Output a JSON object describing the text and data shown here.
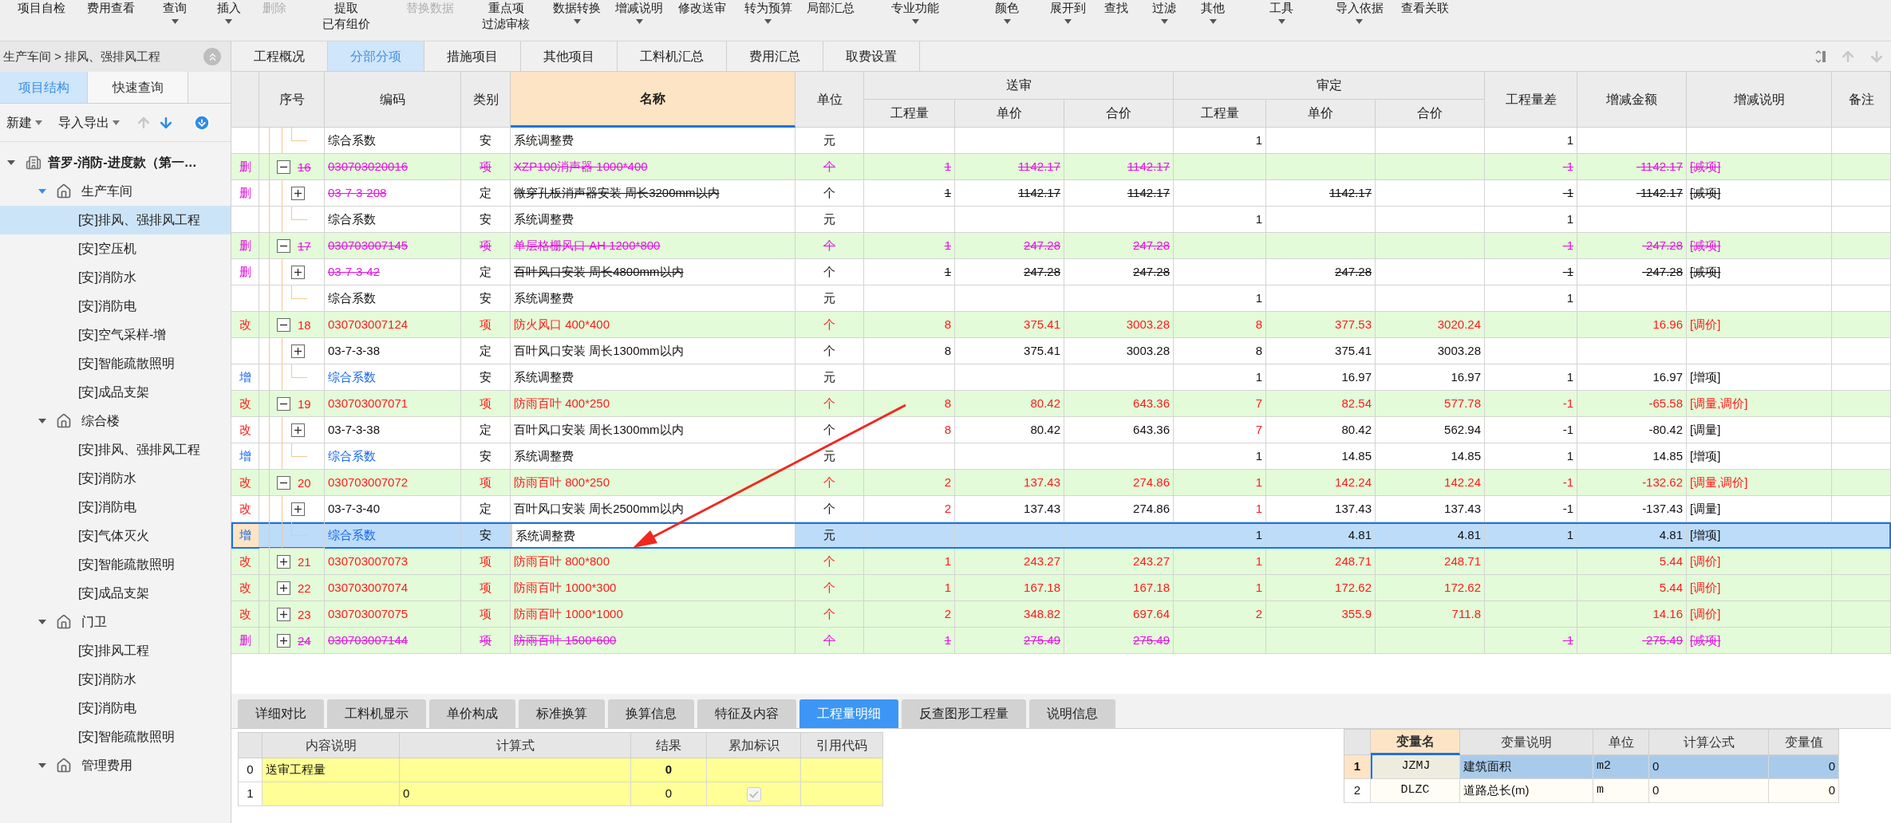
{
  "toolbar": [
    {
      "lines": [
        "项目自检"
      ],
      "dropdown": false,
      "disabled": false
    },
    {
      "lines": [
        "费用查看"
      ],
      "dropdown": false,
      "disabled": false
    },
    {
      "lines": [
        "查询"
      ],
      "dropdown": true,
      "disabled": false
    },
    {
      "lines": [
        "插入"
      ],
      "dropdown": true,
      "disabled": false
    },
    {
      "lines": [
        "删除"
      ],
      "dropdown": false,
      "disabled": true
    },
    {
      "lines": [
        "提取",
        "已有组价"
      ],
      "dropdown": false,
      "disabled": false
    },
    {
      "lines": [
        "替换数据"
      ],
      "dropdown": false,
      "disabled": true
    },
    {
      "lines": [
        "重点项",
        "过滤审核"
      ],
      "dropdown": false,
      "disabled": false
    },
    {
      "lines": [
        "数据转换"
      ],
      "dropdown": true,
      "disabled": false
    },
    {
      "lines": [
        "增减说明"
      ],
      "dropdown": true,
      "disabled": false
    },
    {
      "lines": [
        "修改送审"
      ],
      "dropdown": false,
      "disabled": false
    },
    {
      "lines": [
        "转为预算"
      ],
      "dropdown": true,
      "disabled": false
    },
    {
      "lines": [
        "局部汇总"
      ],
      "dropdown": false,
      "disabled": false
    },
    {
      "lines": [
        "专业功能"
      ],
      "dropdown": true,
      "disabled": false
    },
    {
      "lines": [
        "颜色"
      ],
      "dropdown": true,
      "disabled": false
    },
    {
      "lines": [
        "展开到"
      ],
      "dropdown": true,
      "disabled": false
    },
    {
      "lines": [
        "查找"
      ],
      "dropdown": false,
      "disabled": false
    },
    {
      "lines": [
        "过滤"
      ],
      "dropdown": true,
      "disabled": false
    },
    {
      "lines": [
        "其他"
      ],
      "dropdown": true,
      "disabled": false
    },
    {
      "lines": [
        "工具"
      ],
      "dropdown": true,
      "disabled": false
    },
    {
      "lines": [
        "导入依据"
      ],
      "dropdown": true,
      "disabled": false
    },
    {
      "lines": [
        "查看关联"
      ],
      "dropdown": false,
      "disabled": false
    }
  ],
  "sidebar": {
    "breadcrumb": "生产车间 > 排风、强排风工程",
    "tabs": [
      {
        "label": "项目结构",
        "selected": true
      },
      {
        "label": "快速查询",
        "selected": false
      }
    ],
    "actions": [
      {
        "label": "新建",
        "dropdown": true
      },
      {
        "label": "导入导出",
        "dropdown": true
      }
    ],
    "tree": {
      "label": "普罗-消防-进度款（第一…",
      "expanded": true,
      "selected": false,
      "children": [
        {
          "label": "生产车间",
          "expanded": true,
          "selected": false,
          "children": [
            {
              "label": "[安]排风、强排风工程",
              "selected": true
            },
            {
              "label": "[安]空压机",
              "selected": false
            },
            {
              "label": "[安]消防水",
              "selected": false
            },
            {
              "label": "[安]消防电",
              "selected": false
            },
            {
              "label": "[安]空气采样-增",
              "selected": false
            },
            {
              "label": "[安]智能疏散照明",
              "selected": false
            },
            {
              "label": "[安]成品支架",
              "selected": false
            }
          ]
        },
        {
          "label": "综合楼",
          "expanded": true,
          "selected": false,
          "children": [
            {
              "label": "[安]排风、强排风工程",
              "selected": false
            },
            {
              "label": "[安]消防水",
              "selected": false
            },
            {
              "label": "[安]消防电",
              "selected": false
            },
            {
              "label": "[安]气体灭火",
              "selected": false
            },
            {
              "label": "[安]智能疏散照明",
              "selected": false
            },
            {
              "label": "[安]成品支架",
              "selected": false
            }
          ]
        },
        {
          "label": "门卫",
          "expanded": true,
          "selected": false,
          "children": [
            {
              "label": "[安]排风工程",
              "selected": false
            },
            {
              "label": "[安]消防水",
              "selected": false
            },
            {
              "label": "[安]消防电",
              "selected": false
            },
            {
              "label": "[安]智能疏散照明",
              "selected": false
            }
          ]
        },
        {
          "label": "管理费用",
          "expanded": true,
          "selected": false
        }
      ]
    }
  },
  "tabs": [
    {
      "label": "工程概况",
      "selected": false
    },
    {
      "label": "分部分项",
      "selected": true
    },
    {
      "label": "措施项目",
      "selected": false
    },
    {
      "label": "其他项目",
      "selected": false
    },
    {
      "label": "工料机汇总",
      "selected": false
    },
    {
      "label": "费用汇总",
      "selected": false
    },
    {
      "label": "取费设置",
      "selected": false
    }
  ],
  "table": {
    "columns": [
      {
        "label": "序号",
        "selected": false
      },
      {
        "label": "编码",
        "selected": false
      },
      {
        "label": "类别",
        "selected": false
      },
      {
        "label": "名称",
        "selected": true
      },
      {
        "label": "单位",
        "selected": false
      },
      {
        "label": "送审",
        "selected": false,
        "sub": [
          "工程量",
          "单价",
          "合价"
        ]
      },
      {
        "label": "审定",
        "selected": false,
        "sub": [
          "工程量",
          "单价",
          "合价"
        ]
      },
      {
        "label": "工程量差",
        "selected": false
      },
      {
        "label": "增减金额",
        "selected": false
      },
      {
        "label": "增减说明",
        "selected": false
      },
      {
        "label": "备注",
        "selected": false
      }
    ],
    "rows": [
      {
        "kind": "coef",
        "deleted": false,
        "changed": false,
        "added": false,
        "selected": false,
        "code": "综合系数",
        "type": "安",
        "name": "系统调整费",
        "unit": "元",
        "aq": "1",
        "diff": "1"
      },
      {
        "kind": "item",
        "deleted": true,
        "changed": false,
        "added": false,
        "flag": "删",
        "expanded": true,
        "selected": false,
        "seq": "16",
        "code": "030703020016",
        "type": "项",
        "name": "XZP100消声器 1000*400",
        "unit": "个",
        "sq": "1",
        "sp": "1142.17",
        "st": "1142.17",
        "diff": "-1",
        "amount": "-1142.17",
        "note": "[减项]"
      },
      {
        "kind": "quota",
        "deleted": true,
        "changed": false,
        "added": false,
        "flag": "删",
        "expanded": false,
        "selected": false,
        "code": "03-7-3-208",
        "type": "定",
        "name": "微穿孔板消声器安装 周长3200mm以内",
        "unit": "个",
        "sq": "1",
        "sp": "1142.17",
        "st": "1142.17",
        "ap": "1142.17",
        "diff": "-1",
        "amount": "-1142.17",
        "note": "[减项]"
      },
      {
        "kind": "coef",
        "deleted": false,
        "changed": false,
        "added": false,
        "selected": false,
        "code": "综合系数",
        "type": "安",
        "name": "系统调整费",
        "unit": "元",
        "aq": "1",
        "diff": "1"
      },
      {
        "kind": "item",
        "deleted": true,
        "changed": false,
        "added": false,
        "flag": "删",
        "expanded": true,
        "selected": false,
        "seq": "17",
        "code": "030703007145",
        "type": "项",
        "name": "单层格栅风口 AH 1200*800",
        "unit": "个",
        "sq": "1",
        "sp": "247.28",
        "st": "247.28",
        "diff": "-1",
        "amount": "-247.28",
        "note": "[减项]"
      },
      {
        "kind": "quota",
        "deleted": true,
        "changed": false,
        "added": false,
        "flag": "删",
        "expanded": false,
        "selected": false,
        "code": "03-7-3-42",
        "type": "定",
        "name": "百叶风口安装 周长4800mm以内",
        "unit": "个",
        "sq": "1",
        "sp": "247.28",
        "st": "247.28",
        "ap": "247.28",
        "diff": "-1",
        "amount": "-247.28",
        "note": "[减项]"
      },
      {
        "kind": "coef",
        "deleted": false,
        "changed": false,
        "added": false,
        "selected": false,
        "code": "综合系数",
        "type": "安",
        "name": "系统调整费",
        "unit": "元",
        "aq": "1",
        "diff": "1"
      },
      {
        "kind": "item",
        "deleted": false,
        "changed": true,
        "added": false,
        "flag": "改",
        "expanded": true,
        "selected": false,
        "seq": "18",
        "code": "030703007124",
        "type": "项",
        "name": "防火风口 400*400",
        "unit": "个",
        "sq": "8",
        "sp": "375.41",
        "st": "3003.28",
        "aq": "8",
        "ap": "377.53",
        "at": "3020.24",
        "amount": "16.96",
        "note": "[调价]"
      },
      {
        "kind": "quota",
        "deleted": false,
        "changed": false,
        "added": false,
        "expanded": false,
        "selected": false,
        "code": "03-7-3-38",
        "type": "定",
        "name": "百叶风口安装 周长1300mm以内",
        "unit": "个",
        "sq": "8",
        "sp": "375.41",
        "st": "3003.28",
        "aq": "8",
        "ap": "375.41",
        "at": "3003.28"
      },
      {
        "kind": "coef",
        "deleted": false,
        "changed": false,
        "added": true,
        "flag": "增",
        "selected": false,
        "code": "综合系数",
        "type": "安",
        "name": "系统调整费",
        "unit": "元",
        "aq": "1",
        "ap": "16.97",
        "at": "16.97",
        "diff": "1",
        "amount": "16.97",
        "note": "[增项]"
      },
      {
        "kind": "item",
        "deleted": false,
        "changed": true,
        "added": false,
        "flag": "改",
        "expanded": true,
        "selected": false,
        "seq": "19",
        "code": "030703007071",
        "type": "项",
        "name": "防雨百叶 400*250",
        "unit": "个",
        "sq": "8",
        "sp": "80.42",
        "st": "643.36",
        "aq": "7",
        "ap": "82.54",
        "at": "577.78",
        "diff": "-1",
        "amount": "-65.58",
        "note": "[调量,调价]"
      },
      {
        "kind": "quota",
        "deleted": false,
        "changed": true,
        "added": false,
        "flag": "改",
        "expanded": false,
        "selected": false,
        "code": "03-7-3-38",
        "type": "定",
        "name": "百叶风口安装 周长1300mm以内",
        "unit": "个",
        "sq": "8",
        "sp": "80.42",
        "st": "643.36",
        "aq": "7",
        "ap": "80.42",
        "at": "562.94",
        "diff": "-1",
        "amount": "-80.42",
        "note": "[调量]"
      },
      {
        "kind": "coef",
        "deleted": false,
        "changed": false,
        "added": true,
        "flag": "增",
        "selected": false,
        "code": "综合系数",
        "type": "安",
        "name": "系统调整费",
        "unit": "元",
        "aq": "1",
        "ap": "14.85",
        "at": "14.85",
        "diff": "1",
        "amount": "14.85",
        "note": "[增项]"
      },
      {
        "kind": "item",
        "deleted": false,
        "changed": true,
        "added": false,
        "flag": "改",
        "expanded": true,
        "selected": false,
        "seq": "20",
        "code": "030703007072",
        "type": "项",
        "name": "防雨百叶 800*250",
        "unit": "个",
        "sq": "2",
        "sp": "137.43",
        "st": "274.86",
        "aq": "1",
        "ap": "142.24",
        "at": "142.24",
        "diff": "-1",
        "amount": "-132.62",
        "note": "[调量,调价]"
      },
      {
        "kind": "quota",
        "deleted": false,
        "changed": true,
        "added": false,
        "flag": "改",
        "expanded": false,
        "selected": false,
        "code": "03-7-3-40",
        "type": "定",
        "name": "百叶风口安装 周长2500mm以内",
        "unit": "个",
        "sq": "2",
        "sp": "137.43",
        "st": "274.86",
        "aq": "1",
        "ap": "137.43",
        "at": "137.43",
        "diff": "-1",
        "amount": "-137.43",
        "note": "[调量]"
      },
      {
        "kind": "coef",
        "deleted": false,
        "changed": false,
        "added": true,
        "flag": "增",
        "selected": true,
        "code": "综合系数",
        "type": "安",
        "name": "系统调整费",
        "unit": "元",
        "aq": "1",
        "ap": "4.81",
        "at": "4.81",
        "diff": "1",
        "amount": "4.81",
        "note": "[增项]"
      },
      {
        "kind": "item",
        "deleted": false,
        "changed": true,
        "added": false,
        "flag": "改",
        "expanded": false,
        "selected": false,
        "seq": "21",
        "code": "030703007073",
        "type": "项",
        "name": "防雨百叶 800*800",
        "unit": "个",
        "sq": "1",
        "sp": "243.27",
        "st": "243.27",
        "aq": "1",
        "ap": "248.71",
        "at": "248.71",
        "amount": "5.44",
        "note": "[调价]"
      },
      {
        "kind": "item",
        "deleted": false,
        "changed": true,
        "added": false,
        "flag": "改",
        "expanded": false,
        "selected": false,
        "seq": "22",
        "code": "030703007074",
        "type": "项",
        "name": "防雨百叶 1000*300",
        "unit": "个",
        "sq": "1",
        "sp": "167.18",
        "st": "167.18",
        "aq": "1",
        "ap": "172.62",
        "at": "172.62",
        "amount": "5.44",
        "note": "[调价]"
      },
      {
        "kind": "item",
        "deleted": false,
        "changed": true,
        "added": false,
        "flag": "改",
        "expanded": false,
        "selected": false,
        "seq": "23",
        "code": "030703007075",
        "type": "项",
        "name": "防雨百叶 1000*1000",
        "unit": "个",
        "sq": "2",
        "sp": "348.82",
        "st": "697.64",
        "aq": "2",
        "ap": "355.9",
        "at": "711.8",
        "amount": "14.16",
        "note": "[调价]"
      },
      {
        "kind": "item",
        "deleted": true,
        "changed": false,
        "added": false,
        "flag": "删",
        "expanded": false,
        "selected": false,
        "seq": "24",
        "code": "030703007144",
        "type": "项",
        "name": "防雨百叶 1500*600",
        "unit": "个",
        "sq": "1",
        "sp": "275.49",
        "st": "275.49",
        "diff": "-1",
        "amount": "-275.49",
        "note": "[减项]"
      }
    ]
  },
  "detail_tabs": [
    {
      "label": "详细对比",
      "selected": false
    },
    {
      "label": "工料机显示",
      "selected": false
    },
    {
      "label": "单价构成",
      "selected": false
    },
    {
      "label": "标准换算",
      "selected": false
    },
    {
      "label": "换算信息",
      "selected": false
    },
    {
      "label": "特征及内容",
      "selected": false
    },
    {
      "label": "工程量明细",
      "selected": true
    },
    {
      "label": "反查图形工程量",
      "selected": false
    },
    {
      "label": "说明信息",
      "selected": false
    }
  ],
  "calc_table": {
    "columns": [
      "内容说明",
      "计算式",
      "结果",
      "累加标识",
      "引用代码"
    ],
    "rows": [
      {
        "kind": "total",
        "index": "0",
        "desc": "送审工程量",
        "result": "0"
      },
      {
        "kind": "line",
        "index": "1",
        "formula": "0",
        "result": "0",
        "checked": true,
        "disabled": true
      }
    ]
  },
  "variables": {
    "columns": [
      {
        "label": "变量名",
        "selected": true
      },
      {
        "label": "变量说明",
        "selected": false
      },
      {
        "label": "单位",
        "selected": false
      },
      {
        "label": "计算公式",
        "selected": false
      },
      {
        "label": "变量值",
        "selected": false
      }
    ],
    "rows": [
      {
        "index": "1",
        "name": "JZMJ",
        "desc": "建筑面积",
        "unit": "m2",
        "formula": "0",
        "value": "0",
        "selected": true
      },
      {
        "index": "2",
        "name": "DLZC",
        "desc": "道路总长(m)",
        "unit": "m",
        "formula": "0",
        "value": "0",
        "selected": false
      }
    ]
  }
}
